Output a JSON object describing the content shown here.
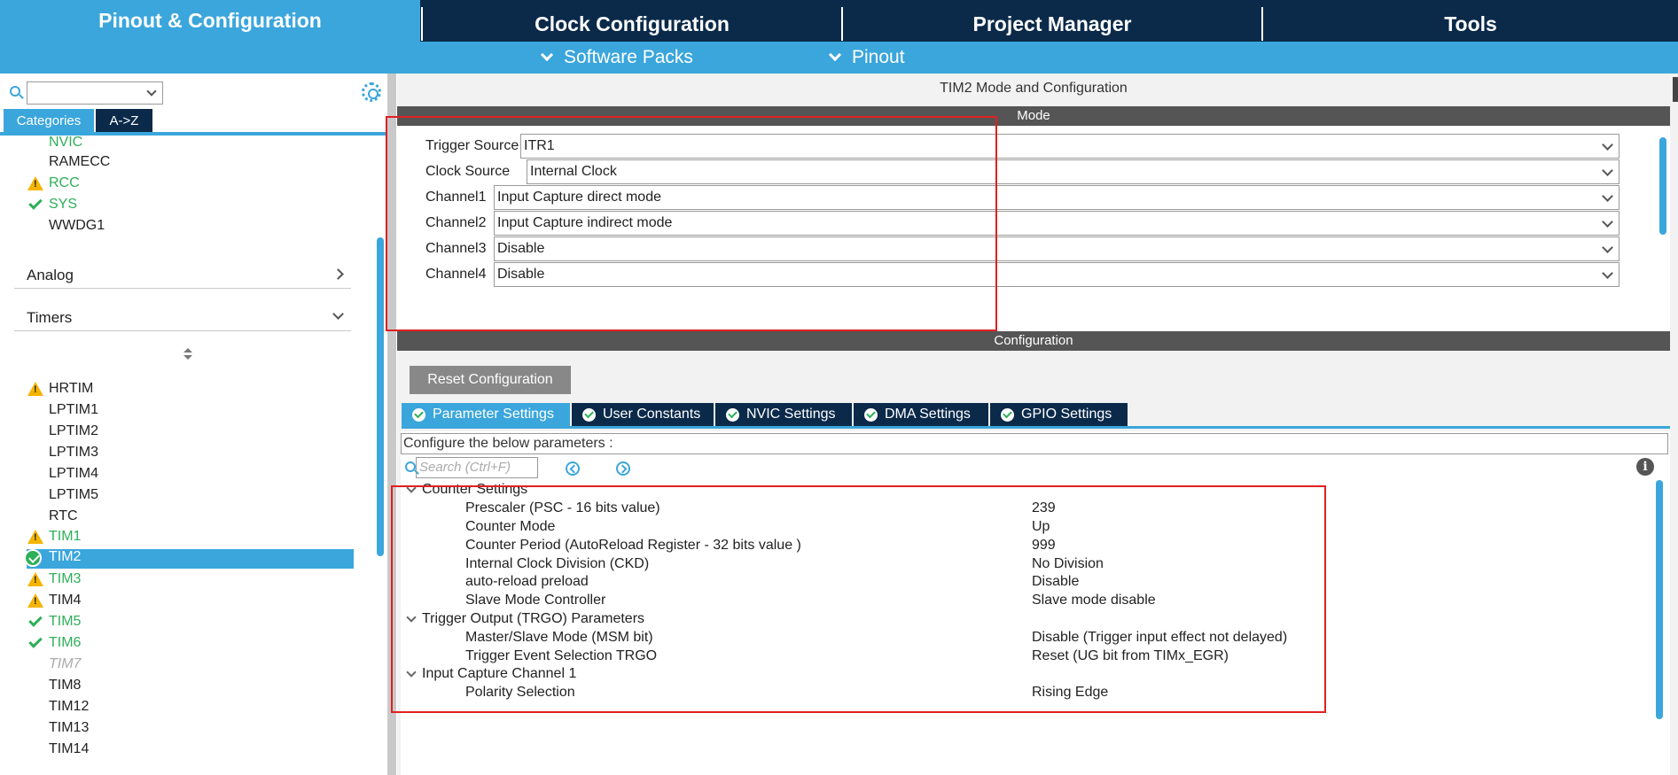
{
  "top_tabs": [
    "Pinout & Configuration",
    "Clock Configuration",
    "Project Manager",
    "Tools"
  ],
  "sub_menu": [
    "Software Packs",
    "Pinout"
  ],
  "left": {
    "category_tabs": [
      "Categories",
      "A->Z"
    ],
    "items_top": [
      {
        "label": "NVIC",
        "status": "none",
        "style": "green"
      },
      {
        "label": "RAMECC",
        "status": "none",
        "style": "normal"
      },
      {
        "label": "RCC",
        "status": "warning",
        "style": "green"
      },
      {
        "label": "SYS",
        "status": "ok",
        "style": "green"
      },
      {
        "label": "WWDG1",
        "status": "none",
        "style": "normal"
      }
    ],
    "group_analog": "Analog",
    "group_timers": "Timers",
    "timers": [
      {
        "label": "HRTIM",
        "status": "warning",
        "style": "normal"
      },
      {
        "label": "LPTIM1",
        "status": "none",
        "style": "normal"
      },
      {
        "label": "LPTIM2",
        "status": "none",
        "style": "normal"
      },
      {
        "label": "LPTIM3",
        "status": "none",
        "style": "normal"
      },
      {
        "label": "LPTIM4",
        "status": "none",
        "style": "normal"
      },
      {
        "label": "LPTIM5",
        "status": "none",
        "style": "normal"
      },
      {
        "label": "RTC",
        "status": "none",
        "style": "normal"
      },
      {
        "label": "TIM1",
        "status": "warning",
        "style": "green"
      },
      {
        "label": "TIM2",
        "status": "ok-selected",
        "style": "selected"
      },
      {
        "label": "TIM3",
        "status": "warning",
        "style": "green"
      },
      {
        "label": "TIM4",
        "status": "warning",
        "style": "normal"
      },
      {
        "label": "TIM5",
        "status": "ok",
        "style": "green"
      },
      {
        "label": "TIM6",
        "status": "ok",
        "style": "green"
      },
      {
        "label": "TIM7",
        "status": "none",
        "style": "disabled"
      },
      {
        "label": "TIM8",
        "status": "none",
        "style": "normal"
      },
      {
        "label": "TIM12",
        "status": "none",
        "style": "normal"
      },
      {
        "label": "TIM13",
        "status": "none",
        "style": "normal"
      },
      {
        "label": "TIM14",
        "status": "none",
        "style": "normal"
      }
    ]
  },
  "right": {
    "title": "TIM2 Mode and Configuration",
    "mode_header": "Mode",
    "mode_rows": [
      {
        "label": "Trigger Source",
        "value": "ITR1"
      },
      {
        "label": "Clock Source",
        "value": "Internal Clock"
      },
      {
        "label": "Channel1",
        "value": "Input Capture direct mode"
      },
      {
        "label": "Channel2",
        "value": "Input Capture indirect mode"
      },
      {
        "label": "Channel3",
        "value": "Disable"
      },
      {
        "label": "Channel4",
        "value": "Disable"
      }
    ],
    "config_header": "Configuration",
    "reset_button": "Reset Configuration",
    "config_tabs": [
      "Parameter Settings",
      "User Constants",
      "NVIC Settings",
      "DMA Settings",
      "GPIO Settings"
    ],
    "hint": "Configure the below parameters :",
    "search_placeholder": "Search (Ctrl+F)",
    "groups": [
      {
        "title": "Counter Settings",
        "params": [
          {
            "name": "Prescaler (PSC - 16 bits value)",
            "value": "239"
          },
          {
            "name": "Counter Mode",
            "value": "Up"
          },
          {
            "name": "Counter Period (AutoReload Register - 32 bits value )",
            "value": "999"
          },
          {
            "name": "Internal Clock Division (CKD)",
            "value": "No Division"
          },
          {
            "name": "auto-reload preload",
            "value": "Disable"
          },
          {
            "name": "Slave Mode Controller",
            "value": "Slave mode disable"
          }
        ]
      },
      {
        "title": "Trigger Output (TRGO) Parameters",
        "params": [
          {
            "name": "Master/Slave Mode (MSM bit)",
            "value": "Disable (Trigger input effect not delayed)"
          },
          {
            "name": "Trigger Event Selection TRGO",
            "value": "Reset (UG bit from TIMx_EGR)"
          }
        ]
      },
      {
        "title": "Input Capture Channel 1",
        "params": [
          {
            "name": "Polarity Selection",
            "value": "Rising Edge"
          }
        ]
      }
    ]
  },
  "colors": {
    "accent": "#3ba6dc",
    "navy": "#0b2a4a",
    "ok": "#2eaf59",
    "warn": "#f5b400",
    "highlight_box": "#e02020"
  }
}
